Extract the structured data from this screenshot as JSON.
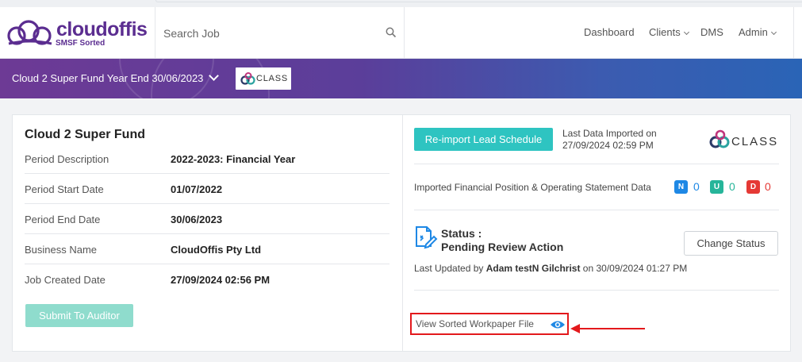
{
  "header": {
    "logo_text": "cloudoffis",
    "logo_subtext": "SMSF Sorted",
    "search_placeholder": "Search Job",
    "nav": [
      {
        "label": "Dashboard",
        "has_dropdown": false
      },
      {
        "label": "Clients",
        "has_dropdown": true
      },
      {
        "label": "DMS",
        "has_dropdown": false
      },
      {
        "label": "Admin",
        "has_dropdown": true
      }
    ]
  },
  "banner": {
    "title": "Cloud 2 Super Fund Year End 30/06/2023",
    "partner_logo_text": "CLASS"
  },
  "job": {
    "fund_name": "Cloud 2 Super Fund",
    "details": [
      {
        "label": "Period Description",
        "value": "2022-2023: Financial Year"
      },
      {
        "label": "Period Start Date",
        "value": "01/07/2022"
      },
      {
        "label": "Period End Date",
        "value": "30/06/2023"
      },
      {
        "label": "Business Name",
        "value": "CloudOffis Pty Ltd"
      },
      {
        "label": "Job Created Date",
        "value": "27/09/2024 02:56 PM"
      }
    ],
    "submit_label": "Submit To Auditor"
  },
  "import": {
    "button_label": "Re-import Lead Schedule",
    "last_import_label": "Last Data Imported on",
    "last_import_date": "27/09/2024 02:59 PM",
    "logo_text": "CLASS",
    "data_label": "Imported Financial Position & Operating Statement Data",
    "badges": [
      {
        "letter": "N",
        "count": "0",
        "color": "#1e88e5"
      },
      {
        "letter": "U",
        "count": "0",
        "color": "#26b59a"
      },
      {
        "letter": "D",
        "count": "0",
        "color": "#e53935"
      }
    ]
  },
  "status": {
    "label": "Status :",
    "value": "Pending Review Action",
    "change_label": "Change Status",
    "updated_prefix": "Last Updated by",
    "updated_by": "Adam testN Gilchrist",
    "updated_on": "on 30/09/2024 01:27 PM"
  },
  "workpaper": {
    "link_label": "View Sorted Workpaper File"
  },
  "colors": {
    "brand": "#5b2d90",
    "accent": "#2ec4c1",
    "highlight": "#e3191c"
  }
}
